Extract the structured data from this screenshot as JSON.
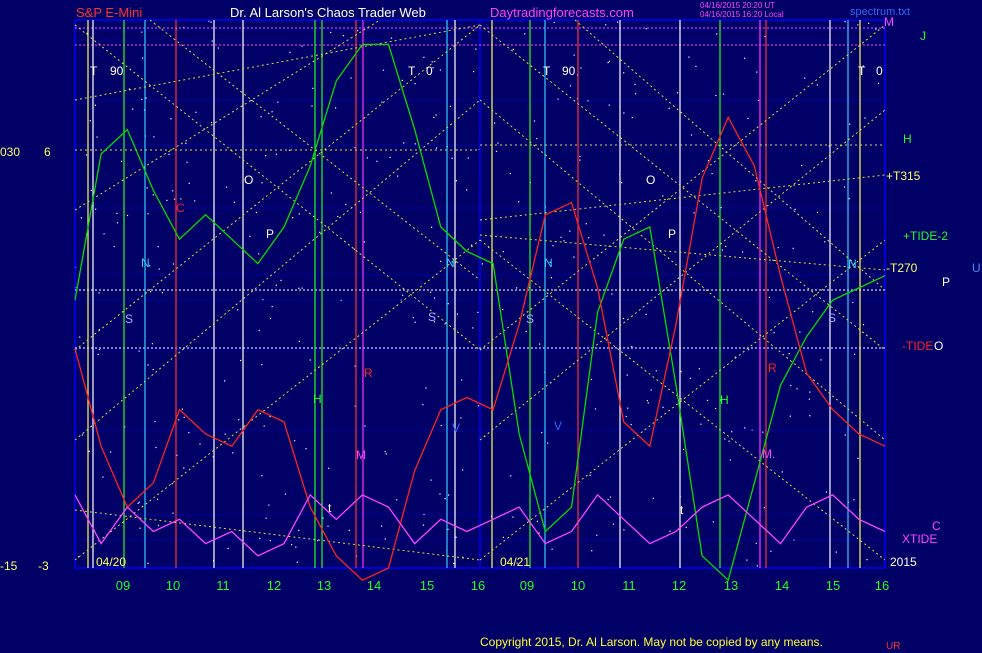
{
  "header": {
    "symbol": "S&P E-Mini",
    "title": "Dr. Al Larson's Chaos Trader Web",
    "site": "Daytradingforecasts.com",
    "stamp1": "04/16/2015 20:20 UT",
    "stamp2": "04/16/2015 16:20 Local",
    "file": "spectrum.txt"
  },
  "left_axis": {
    "top_a": "030",
    "top_b": "6",
    "bot_a": "-15",
    "bot_b": "-3"
  },
  "year": "2015",
  "copyright": "Copyright 2015, Dr. Al Larson. May not be copied by any means.",
  "corner_mark": "UR",
  "colors": {
    "bg": "#000066",
    "grid": "#0000ff",
    "dots": "#ffffff",
    "tide": "#00dd00",
    "tide_red": "#ff2222",
    "xtide": "#ff44ff",
    "gann": "#dddd33",
    "red_line": "#ff3333",
    "cyan_line": "#33ccff",
    "green_line": "#22ff22",
    "white_line": "#ffffff",
    "yellow_line": "#ffff55",
    "magenta_line": "#ff33ff"
  },
  "chart_data": {
    "type": "line",
    "x": [
      "04/20 08:30",
      "04/20 09:00",
      "04/20 09:30",
      "04/20 10:00",
      "04/20 10:30",
      "04/20 11:00",
      "04/20 11:30",
      "04/20 12:00",
      "04/20 12:30",
      "04/20 13:00",
      "04/20 13:30",
      "04/20 14:00",
      "04/20 14:30",
      "04/20 15:00",
      "04/20 15:30",
      "04/20 16:00",
      "04/21 08:30",
      "04/21 09:00",
      "04/21 09:30",
      "04/21 10:00",
      "04/21 10:30",
      "04/21 11:00",
      "04/21 11:30",
      "04/21 12:00",
      "04/21 12:30",
      "04/21 13:00",
      "04/21 13:30",
      "04/21 14:00",
      "04/21 14:30",
      "04/21 15:00",
      "04/21 15:30",
      "04/21 16:00"
    ],
    "days": [
      {
        "label": "04/20",
        "hours": [
          "09",
          "10",
          "11",
          "12",
          "13",
          "14",
          "15",
          "16"
        ]
      },
      {
        "label": "04/21",
        "hours": [
          "09",
          "10",
          "11",
          "12",
          "13",
          "14",
          "15",
          "16"
        ]
      }
    ],
    "ylim": [
      -15,
      30
    ],
    "series": [
      {
        "name": "+TIDE-2",
        "color": "#00dd00",
        "values": [
          7,
          19,
          21,
          16,
          12,
          14,
          12,
          10,
          13,
          18,
          25,
          28,
          28,
          21,
          13,
          11,
          10,
          -4,
          -12,
          -10,
          6,
          12,
          13,
          0,
          -14,
          -16,
          -8,
          0,
          4,
          7,
          8,
          9
        ]
      },
      {
        "name": "-TIDE",
        "color": "#ff2222",
        "values": [
          3,
          -5,
          -10,
          -8,
          -2,
          -4,
          -5,
          -2,
          -3,
          -10,
          -14,
          -16,
          -15,
          -7,
          -2,
          -1,
          -2,
          5,
          14,
          15,
          8,
          -3,
          -5,
          5,
          17,
          22,
          18,
          9,
          1,
          -2,
          -4,
          -5
        ]
      },
      {
        "name": "XTIDE",
        "color": "#ff44ff",
        "values": [
          -9,
          -13,
          -10,
          -12,
          -11,
          -13,
          -12,
          -14,
          -13,
          -9,
          -11,
          -9,
          -10,
          -13,
          -11,
          -12,
          -11,
          -10,
          -13,
          -12,
          -9,
          -11,
          -13,
          -12,
          -10,
          -9,
          -11,
          -13,
          -10,
          -9,
          -11,
          -12
        ]
      }
    ],
    "right_labels": [
      {
        "text": "M",
        "color": "#ff44ff"
      },
      {
        "text": "J",
        "color": "#22ff22"
      },
      {
        "text": "H",
        "color": "#22ff22"
      },
      {
        "text": "+T315",
        "color": "#ffff66"
      },
      {
        "text": "+TIDE-2",
        "color": "#22ff22"
      },
      {
        "text": "-T270",
        "color": "#ffff66"
      },
      {
        "text": "U",
        "color": "#3399ff"
      },
      {
        "text": "P",
        "color": "#ffffff"
      },
      {
        "text": "-TIDE",
        "color": "#ff2222"
      },
      {
        "text": "O",
        "color": "#ffffff"
      },
      {
        "text": "C",
        "color": "#ff44ff"
      },
      {
        "text": "XTIDE",
        "color": "#ff44ff"
      }
    ],
    "markers": [
      {
        "text": "T",
        "color": "#ffffff"
      },
      {
        "text": "90",
        "color": "#ffffff"
      },
      {
        "text": "T",
        "color": "#ffffff"
      },
      {
        "text": "0",
        "color": "#ffffff"
      },
      {
        "text": "T",
        "color": "#ffffff"
      },
      {
        "text": "90",
        "color": "#ffffff"
      },
      {
        "text": "T",
        "color": "#ffffff"
      },
      {
        "text": "0",
        "color": "#ffffff"
      },
      {
        "text": "C",
        "color": "#ff2222"
      },
      {
        "text": "O",
        "color": "#ffffff"
      },
      {
        "text": "P",
        "color": "#ffffff"
      },
      {
        "text": "N",
        "color": "#33ccff"
      },
      {
        "text": "S",
        "color": "#aaaaff"
      },
      {
        "text": "N",
        "color": "#33ccff"
      },
      {
        "text": "S",
        "color": "#aaaaff"
      },
      {
        "text": "R",
        "color": "#ff2222"
      },
      {
        "text": "H",
        "color": "#22ff22"
      },
      {
        "text": "M",
        "color": "#ff44ff"
      },
      {
        "text": "V",
        "color": "#3366ff"
      },
      {
        "text": "t",
        "color": "#ffffff"
      },
      {
        "text": "N",
        "color": "#33ccff"
      },
      {
        "text": "S",
        "color": "#aaaaff"
      },
      {
        "text": "V",
        "color": "#3366ff"
      },
      {
        "text": "O",
        "color": "#ffffff"
      },
      {
        "text": "P",
        "color": "#ffffff"
      },
      {
        "text": "H",
        "color": "#22ff22"
      },
      {
        "text": "M.",
        "color": "#ff44ff"
      },
      {
        "text": "R",
        "color": "#ff2222"
      },
      {
        "text": "t",
        "color": "#ffffff"
      },
      {
        "text": "S",
        "color": "#aaaaff"
      },
      {
        "text": "N",
        "color": "#33ccff"
      }
    ]
  }
}
